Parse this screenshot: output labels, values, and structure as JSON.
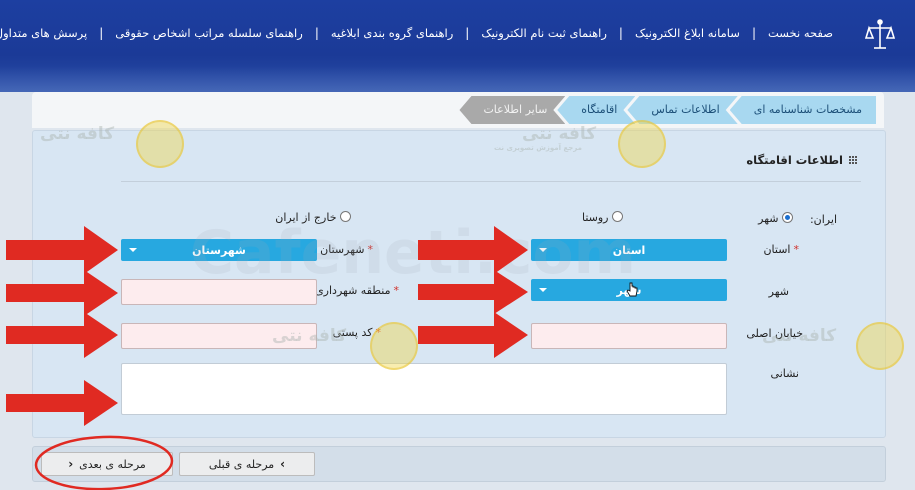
{
  "nav": {
    "home": "صفحه نخست",
    "e_notice_system": "سامانه ابلاغ الکترونیک",
    "e_registration_guide": "راهنمای ثبت نام الکترونیک",
    "notice_grouping_guide": "راهنمای گروه بندی ابلاغیه",
    "legal_persons_hierarchy_guide": "راهنمای سلسله مراتب اشخاص حقوقی",
    "faq": "پرسش های متداول",
    "separator": "|"
  },
  "steps": [
    {
      "label": "مشخصات شناسنامه ای",
      "state": "done"
    },
    {
      "label": "اطلاعات تماس",
      "state": "done"
    },
    {
      "label": "اقامتگاه",
      "state": "active"
    },
    {
      "label": "سایر اطلاعات",
      "state": "disabled"
    }
  ],
  "form": {
    "title": "اطلاعات اقامتگاه",
    "iran_label": "ایران:",
    "city_option": "شهر",
    "village_option": "روستا",
    "abroad_option": "خارج از ایران",
    "selected_location": "شهر",
    "province_label": "استان",
    "province_value": "استان",
    "county_label": "شهرستان",
    "county_value": "شهرستان",
    "city_label": "شهر",
    "city_value": "شهر",
    "municipal_district_label": "منطقه شهرداری",
    "main_street_label": "خیابان اصلی",
    "postal_code_label": "کد پستی",
    "address_label": "نشانی",
    "required_mark": "*"
  },
  "buttons": {
    "previous": "مرحله ی قبلی",
    "next": "مرحله ی بعدی"
  },
  "watermark": {
    "site": "Cafeneti.com",
    "brand": "کافه نتی",
    "badge": "کافه",
    "tagline": "مرجع آموزش تصویری نت"
  },
  "colors": {
    "header_blue": "#1d3fa1",
    "step_active": "#a8d8f0",
    "step_disabled": "#a9a9a9",
    "dropdown": "#27a8e0",
    "field_invalid_bg": "#fdecee",
    "annotation_red": "#e02a22"
  }
}
